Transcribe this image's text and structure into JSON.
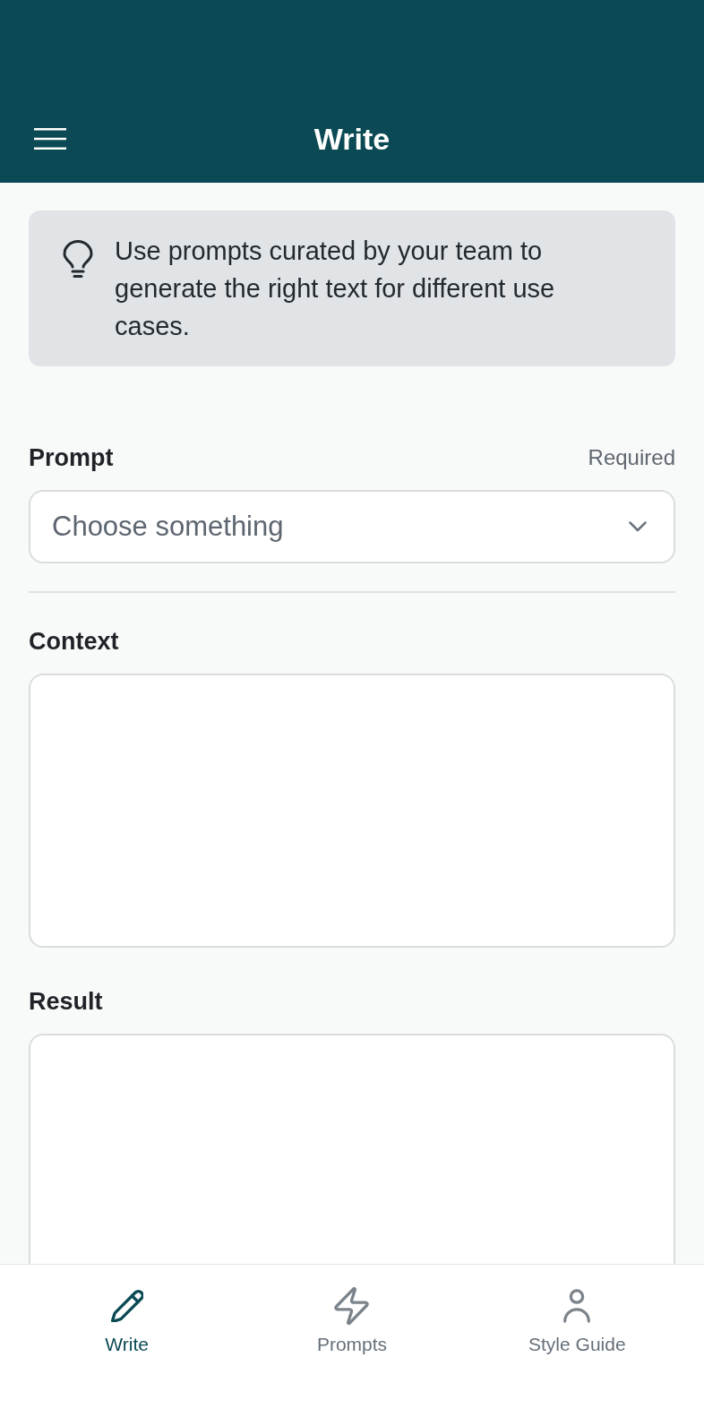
{
  "header": {
    "title": "Write"
  },
  "tip": {
    "text": "Use prompts curated by your team to generate the right text for different use cases."
  },
  "fields": [
    {
      "kind": "select",
      "label": "Prompt",
      "note": "Required",
      "placeholder": "Choose something"
    },
    {
      "kind": "textarea",
      "label": "Context"
    },
    {
      "kind": "textarea",
      "label": "Result"
    }
  ],
  "nav": [
    {
      "label": "Write",
      "selected": true
    },
    {
      "label": "Prompts",
      "selected": false
    },
    {
      "label": "Style Guide",
      "selected": false
    }
  ]
}
